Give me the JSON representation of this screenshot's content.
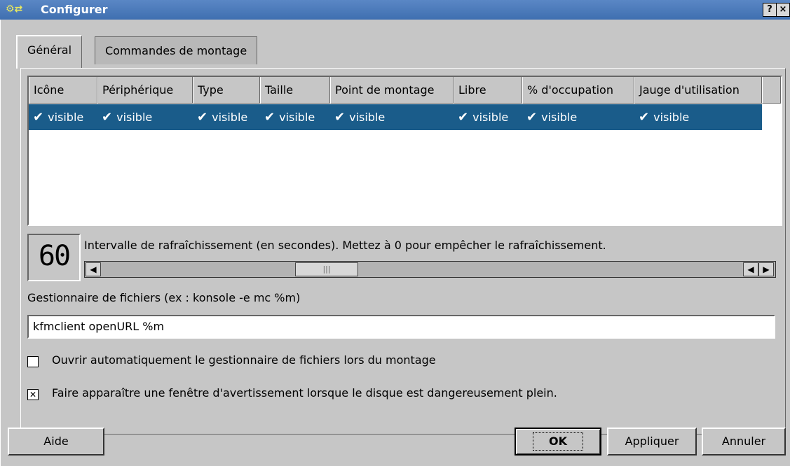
{
  "window": {
    "title": "Configurer",
    "help_btn": "?",
    "close_btn": "×"
  },
  "tabs": [
    {
      "label": "Général"
    },
    {
      "label": "Commandes de montage"
    }
  ],
  "columns": [
    "Icône",
    "Périphérique",
    "Type",
    "Taille",
    "Point de montage",
    "Libre",
    "% d'occupation",
    "Jauge d'utilisation"
  ],
  "row_values": [
    "visible",
    "visible",
    "visible",
    "visible",
    "visible",
    "visible",
    "visible",
    "visible"
  ],
  "refresh": {
    "lcd_value": "60",
    "label": "Intervalle de rafraîchissement (en secondes). Mettez à 0 pour empêcher le rafraîchissement."
  },
  "filemanager": {
    "label": "Gestionnaire de fichiers (ex : konsole -e mc %m)",
    "value": "kfmclient openURL %m"
  },
  "options": {
    "auto_open": {
      "label": "Ouvrir automatiquement le gestionnaire de fichiers lors du montage",
      "checked": false
    },
    "warn_full": {
      "label": "Faire apparaître une fenêtre d'avertissement lorsque le disque est dangereusement plein.",
      "checked": true
    }
  },
  "buttons": {
    "help": "Aide",
    "ok": "OK",
    "apply": "Appliquer",
    "cancel": "Annuler"
  },
  "colors": {
    "selection": "#1a5c8a",
    "titlebar": "#4a7bbd"
  }
}
